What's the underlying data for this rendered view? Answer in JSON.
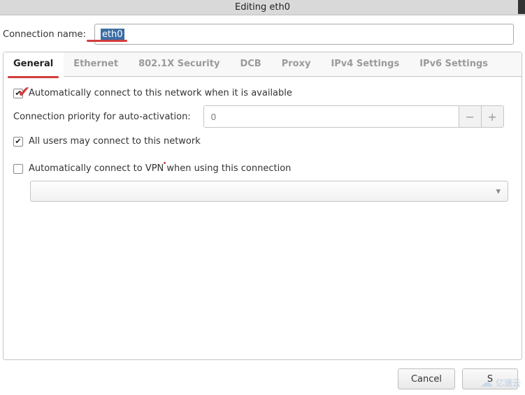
{
  "title": "Editing eth0",
  "connection_name_label": "Connection name:",
  "connection_name_value": "eth0",
  "tabs": {
    "general": "General",
    "ethernet": "Ethernet",
    "sec8021x": "802.1X Security",
    "dcb": "DCB",
    "proxy": "Proxy",
    "ipv4": "IPv4 Settings",
    "ipv6": "IPv6 Settings"
  },
  "general": {
    "auto_connect_label": "Automatically connect to this network when it is available",
    "auto_connect_checked": true,
    "priority_label": "Connection priority for auto-activation:",
    "priority_value": "0",
    "all_users_label": "All users may connect to this network",
    "all_users_checked": true,
    "auto_vpn_label": "Automatically connect to VPN when using this connection",
    "auto_vpn_checked": false,
    "vpn_selection": ""
  },
  "spin": {
    "minus": "−",
    "plus": "+"
  },
  "combo_arrow": "▾",
  "footer": {
    "cancel": "Cancel",
    "save": "S"
  },
  "watermark": "亿速云"
}
